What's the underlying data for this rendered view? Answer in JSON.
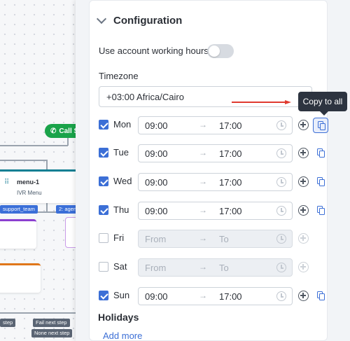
{
  "canvas": {
    "call_node_label": "Call S",
    "menu_node": {
      "title": "menu-1",
      "subtitle": "IVR Menu"
    },
    "tags": {
      "support_team": "support_team",
      "agent": "2: agen",
      "step": "step",
      "fail_next_step": "Fail next step",
      "none_next_step": "None next step"
    }
  },
  "panel": {
    "section_title": "Configuration",
    "working_hours_label": "Use account working hours",
    "working_hours_enabled": false,
    "timezone_label": "Timezone",
    "timezone_value": "+03:00 Africa/Cairo",
    "tooltip": "Copy to all",
    "holidays_title": "Holidays",
    "add_more_label": "Add more",
    "accent_color": "#3c6fd6",
    "annotation_color": "#e03a2f",
    "days": [
      {
        "name": "Mon",
        "checked": true,
        "from": "09:00",
        "to": "17:00"
      },
      {
        "name": "Tue",
        "checked": true,
        "from": "09:00",
        "to": "17:00"
      },
      {
        "name": "Wed",
        "checked": true,
        "from": "09:00",
        "to": "17:00"
      },
      {
        "name": "Thu",
        "checked": true,
        "from": "09:00",
        "to": "17:00"
      },
      {
        "name": "Fri",
        "checked": false,
        "from": "From",
        "to": "To"
      },
      {
        "name": "Sat",
        "checked": false,
        "from": "From",
        "to": "To"
      },
      {
        "name": "Sun",
        "checked": true,
        "from": "09:00",
        "to": "17:00"
      }
    ],
    "separator_glyph": "→"
  }
}
